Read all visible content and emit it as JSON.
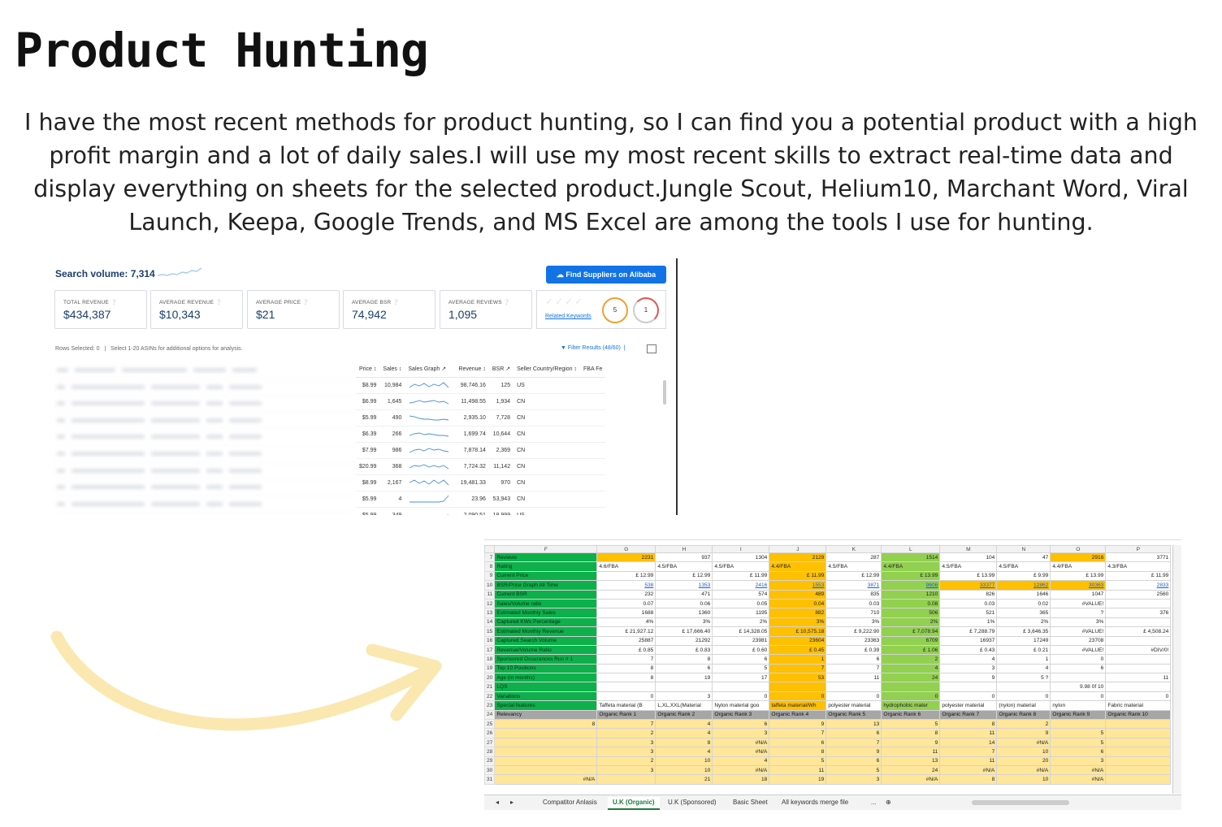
{
  "title": "Product Hunting",
  "description": "I have the most recent methods for product hunting, so I can find you a potential product with a high profit margin and a lot of daily sales.I will use my most recent skills to extract real-time data and display everything on sheets for the selected product.Jungle Scout, Helium10, Marchant Word, Viral Launch, Keepa, Google Trends, and MS Excel are among the tools I use for hunting.",
  "research": {
    "search_volume": "Search volume: 7,314",
    "alibaba_button": "Find Suppliers on Alibaba",
    "stats": [
      {
        "label": "TOTAL REVENUE",
        "value": "$434,387"
      },
      {
        "label": "AVERAGE REVENUE",
        "value": "$10,343"
      },
      {
        "label": "AVERAGE PRICE",
        "value": "$21"
      },
      {
        "label": "AVERAGE BSR",
        "value": "74,942"
      },
      {
        "label": "AVERAGE REVIEWS",
        "value": "1,095"
      }
    ],
    "related_keywords": "Related Keywords",
    "ring1": "5",
    "ring2": "1",
    "rows_selected": "Rows Selected: 0",
    "select_hint": "Select 1-20 ASINs for additional options for analysis.",
    "filter_results": "Filter Results (48/60)",
    "columns": [
      "Price",
      "Sales",
      "Sales Graph",
      "Revenue",
      "BSR",
      "Seller Country/Region",
      "FBA Fe"
    ],
    "rows": [
      [
        "$8.99",
        "10,984",
        "98,746.16",
        "125",
        "US"
      ],
      [
        "$6.99",
        "1,645",
        "11,498.55",
        "1,934",
        "CN"
      ],
      [
        "$5.99",
        "490",
        "2,935.10",
        "7,728",
        "CN"
      ],
      [
        "$6.39",
        "266",
        "1,699.74",
        "10,644",
        "CN"
      ],
      [
        "$7.99",
        "986",
        "7,878.14",
        "2,369",
        "CN"
      ],
      [
        "$20.99",
        "368",
        "7,724.32",
        "11,142",
        "CN"
      ],
      [
        "$8.99",
        "2,167",
        "19,481.33",
        "970",
        "CN"
      ],
      [
        "$5.99",
        "4",
        "23.96",
        "53,943",
        "CN"
      ],
      [
        "$5.99",
        "349",
        "2,090.51",
        "18,999",
        "US"
      ]
    ]
  },
  "sheet": {
    "columns": [
      "F",
      "G",
      "H",
      "I",
      "J",
      "K",
      "L",
      "M",
      "N",
      "O",
      "P"
    ],
    "rows": [
      {
        "n": "7",
        "label": "Reviews",
        "cells": [
          "2231",
          "937",
          "1304",
          "2129",
          "287",
          "1514",
          "104",
          "47",
          "2916",
          "3771"
        ]
      },
      {
        "n": "8",
        "label": "Rating",
        "cells": [
          "4.6/FBA",
          "4.5/FBA",
          "4.5/FBA",
          "4.4/FBA",
          "4.5/FBA",
          "4.4/FBA",
          "4.5/FBA",
          "4.5/FBA",
          "4.4/FBA",
          "4.3/FBA"
        ]
      },
      {
        "n": "9",
        "label": "Current Price",
        "cells": [
          "£ 12.99",
          "£ 12.99",
          "£ 11.99",
          "£ 11.99",
          "£ 12.99",
          "£ 13.99",
          "£ 13.99",
          "£ 9.99",
          "£ 13.99",
          "£ 11.99"
        ]
      },
      {
        "n": "10",
        "label": "BSR/Price Graph All Time",
        "cells": [
          "538",
          "1353",
          "2416",
          "1553",
          "3871",
          "9606",
          "33377",
          "12862",
          "30363",
          "2833"
        ]
      },
      {
        "n": "11",
        "label": "Current BSR",
        "cells": [
          "232",
          "471",
          "574",
          "489",
          "835",
          "1210",
          "826",
          "1646",
          "1047",
          "2560"
        ]
      },
      {
        "n": "12",
        "label": "Sales/Volume ratio",
        "cells": [
          "0.07",
          "0.06",
          "0.05",
          "0.04",
          "0.03",
          "0.08",
          "0.03",
          "0.02",
          "#VALUE!",
          ""
        ]
      },
      {
        "n": "13",
        "label": "Estimated Monthly Sales",
        "cells": [
          "1688",
          "1360",
          "1195",
          "882",
          "710",
          "506",
          "521",
          "365",
          "?",
          "376"
        ]
      },
      {
        "n": "14",
        "label": "Captured KWs Percentage",
        "cells": [
          "4%",
          "3%",
          "2%",
          "3%",
          "3%",
          "2%",
          "1%",
          "2%",
          "3%",
          ""
        ]
      },
      {
        "n": "15",
        "label": "Estimated Monthly Revenue",
        "cells": [
          "£ 21,927.12",
          "£ 17,666.40",
          "£ 14,328.05",
          "£ 10,575.18",
          "£ 9,222.90",
          "£ 7,078.94",
          "£ 7,288.79",
          "£ 3,646.35",
          "#VALUE!",
          "£ 4,508.24"
        ]
      },
      {
        "n": "16",
        "label": "Captured Search Volume",
        "cells": [
          "25887",
          "21292",
          "23981",
          "23604",
          "23363",
          "6709",
          "16937",
          "17249",
          "23708",
          ""
        ]
      },
      {
        "n": "17",
        "label": "Revenue/Volume Ratio",
        "cells": [
          "£ 0.85",
          "£ 0.83",
          "£ 0.60",
          "£ 0.45",
          "£ 0.39",
          "£ 1.06",
          "£ 0.43",
          "£ 0.21",
          "#VALUE!",
          "#DIV/0!"
        ]
      },
      {
        "n": "18",
        "label": "Sponsored Occurances Run # 1",
        "cells": [
          "7",
          "8",
          "6",
          "1",
          "6",
          "2",
          "4",
          "1",
          "0",
          ""
        ]
      },
      {
        "n": "19",
        "label": "Top 10 Positions",
        "cells": [
          "8",
          "6",
          "5",
          "7",
          "7",
          "4",
          "3",
          "4",
          "6",
          ""
        ]
      },
      {
        "n": "20",
        "label": "Age (in months)",
        "cells": [
          "8",
          "19",
          "17",
          "53",
          "11",
          "24",
          "9",
          "5 ?",
          "",
          "11"
        ]
      },
      {
        "n": "21",
        "label": "LQS",
        "cells": [
          "",
          "",
          "",
          "",
          "",
          "",
          "",
          "",
          "9.98 0f 10",
          ""
        ]
      },
      {
        "n": "22",
        "label": "Variations",
        "cells": [
          "0",
          "3",
          "0",
          "0",
          "0",
          "0",
          "0",
          "0",
          "0",
          "0"
        ]
      },
      {
        "n": "23",
        "label": "Special features",
        "cells": [
          "Taffeta material (B",
          "L,XL,XXL(Material",
          "Nylon material goo",
          "taffeta material/Wh",
          "polyester material",
          "hydrophobic mater",
          "polyester material",
          "(nylon) material",
          "nylon",
          "Fabric material"
        ]
      }
    ],
    "rank_row": {
      "n": "24",
      "label": "Relevancy",
      "cells": [
        "Organic Rank 1",
        "Organic Rank 2",
        "Organic Rank 3",
        "Organic Rank 4",
        "Organic Rank 5",
        "Organic Rank 6",
        "Organic Rank 7",
        "Organic Rank 8",
        "Organic Rank 9",
        "Organic Rank 10"
      ]
    },
    "body_rows": [
      {
        "n": "25",
        "cells": [
          "8",
          "7",
          "4",
          "6",
          "9",
          "13",
          "5",
          "8",
          "2",
          ""
        ]
      },
      {
        "n": "26",
        "cells": [
          "",
          "2",
          "4",
          "3",
          "7",
          "6",
          "8",
          "11",
          "9",
          "5"
        ]
      },
      {
        "n": "27",
        "cells": [
          "",
          "3",
          "8",
          "#N/A",
          "6",
          "7",
          "9",
          "14",
          "#N/A",
          "5"
        ]
      },
      {
        "n": "28",
        "cells": [
          "",
          "3",
          "4",
          "#N/A",
          "8",
          "9",
          "11",
          "7",
          "10",
          "6"
        ]
      },
      {
        "n": "29",
        "cells": [
          "",
          "2",
          "10",
          "4",
          "5",
          "6",
          "13",
          "11",
          "20",
          "3"
        ]
      },
      {
        "n": "30",
        "cells": [
          "",
          "3",
          "10",
          "#N/A",
          "11",
          "5",
          "24",
          "#N/A",
          "#N/A",
          "#N/A"
        ]
      },
      {
        "n": "31",
        "cells": [
          "#N/A",
          "",
          "21",
          "18",
          "19",
          "3",
          "#N/A",
          "8",
          "10",
          "#N/A"
        ]
      }
    ],
    "tabs": [
      "Compatitor Anlasis",
      "U.K (Organic)",
      "U.K (Sponsored)",
      "Basic Sheet",
      "All keywords merge file",
      "..."
    ]
  }
}
